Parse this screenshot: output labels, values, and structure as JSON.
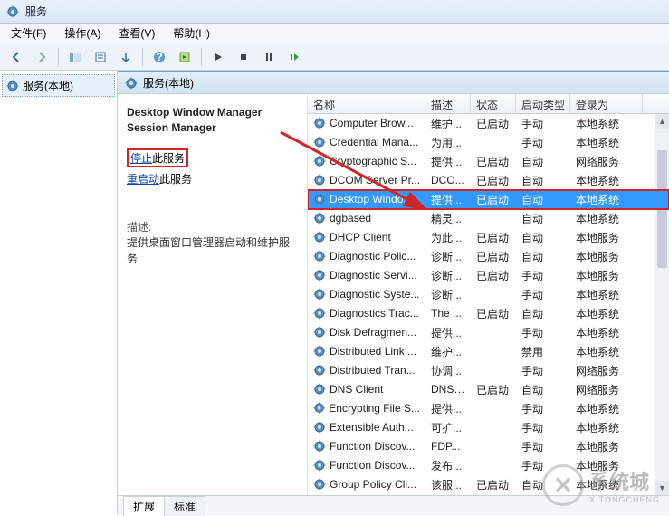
{
  "window": {
    "title": "服务"
  },
  "menubar": {
    "file": "文件(F)",
    "action": "操作(A)",
    "view": "查看(V)",
    "help": "帮助(H)"
  },
  "tree": {
    "root": "服务(本地)"
  },
  "right_header": {
    "label": "服务(本地)"
  },
  "detail": {
    "title_line1": "Desktop Window Manager",
    "title_line2": "Session Manager",
    "stop_link": "停止",
    "stop_suffix": "此服务",
    "restart_link": "重启动",
    "restart_suffix": "此服务",
    "desc_label": "描述:",
    "desc_body": "提供桌面窗口管理器启动和维护服务"
  },
  "columns": {
    "name": "名称",
    "desc": "描述",
    "status": "状态",
    "start": "启动类型",
    "logon": "登录为"
  },
  "services": [
    {
      "name": "Computer Brow...",
      "desc": "维护...",
      "status": "已启动",
      "start": "手动",
      "logon": "本地系统"
    },
    {
      "name": "Credential Mana...",
      "desc": "为用...",
      "status": "",
      "start": "手动",
      "logon": "本地系统"
    },
    {
      "name": "Cryptographic S...",
      "desc": "提供...",
      "status": "已启动",
      "start": "自动",
      "logon": "网络服务"
    },
    {
      "name": "DCOM Server Pr...",
      "desc": "DCO...",
      "status": "已启动",
      "start": "自动",
      "logon": "本地系统"
    },
    {
      "name": "Desktop Windo...",
      "desc": "提供...",
      "status": "已启动",
      "start": "自动",
      "logon": "本地系统",
      "selected": true,
      "highlighted": true
    },
    {
      "name": "dgbased",
      "desc": "精灵...",
      "status": "",
      "start": "自动",
      "logon": "本地系统"
    },
    {
      "name": "DHCP Client",
      "desc": "为此...",
      "status": "已启动",
      "start": "自动",
      "logon": "本地服务"
    },
    {
      "name": "Diagnostic Polic...",
      "desc": "诊断...",
      "status": "已启动",
      "start": "自动",
      "logon": "本地服务"
    },
    {
      "name": "Diagnostic Servi...",
      "desc": "诊断...",
      "status": "已启动",
      "start": "手动",
      "logon": "本地服务"
    },
    {
      "name": "Diagnostic Syste...",
      "desc": "诊断...",
      "status": "",
      "start": "手动",
      "logon": "本地系统"
    },
    {
      "name": "Diagnostics Trac...",
      "desc": "The ...",
      "status": "已启动",
      "start": "自动",
      "logon": "本地系统"
    },
    {
      "name": "Disk Defragmen...",
      "desc": "提供...",
      "status": "",
      "start": "手动",
      "logon": "本地系统"
    },
    {
      "name": "Distributed Link ...",
      "desc": "维护...",
      "status": "",
      "start": "禁用",
      "logon": "本地系统"
    },
    {
      "name": "Distributed Tran...",
      "desc": "协调...",
      "status": "",
      "start": "手动",
      "logon": "网络服务"
    },
    {
      "name": "DNS Client",
      "desc": "DNS ...",
      "status": "已启动",
      "start": "自动",
      "logon": "网络服务"
    },
    {
      "name": "Encrypting File S...",
      "desc": "提供...",
      "status": "",
      "start": "手动",
      "logon": "本地系统"
    },
    {
      "name": "Extensible Auth...",
      "desc": "可扩...",
      "status": "",
      "start": "手动",
      "logon": "本地系统"
    },
    {
      "name": "Function Discov...",
      "desc": "FDP...",
      "status": "",
      "start": "手动",
      "logon": "本地服务"
    },
    {
      "name": "Function Discov...",
      "desc": "发布...",
      "status": "",
      "start": "手动",
      "logon": "本地服务"
    },
    {
      "name": "Group Policy Cli...",
      "desc": "该服...",
      "status": "已启动",
      "start": "自动",
      "logon": "本地系统"
    }
  ],
  "tabs": {
    "extended": "扩展",
    "standard": "标准"
  },
  "watermark": {
    "text": "系统城",
    "sub": "XITONGCHENG"
  }
}
